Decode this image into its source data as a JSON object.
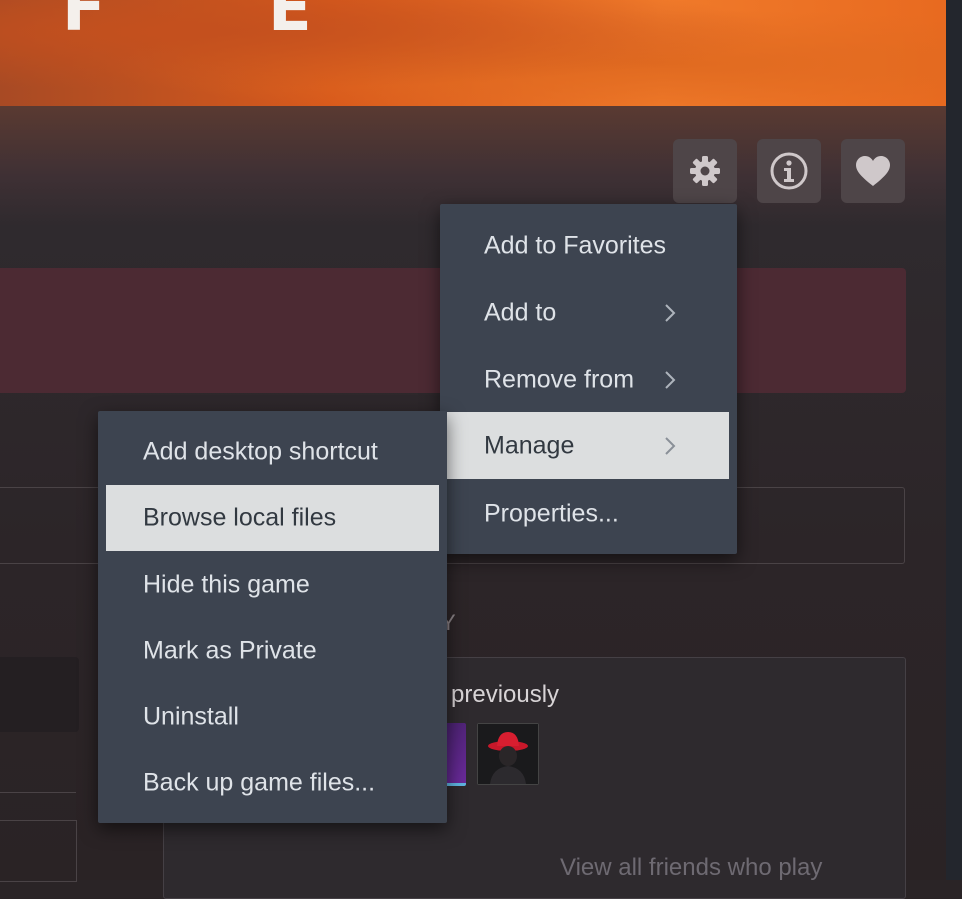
{
  "hero": {
    "title_fragment": "F E"
  },
  "toolbar": {
    "settings_icon": "gear-icon",
    "info_icon": "info-icon",
    "favorite_icon": "heart-icon"
  },
  "context_menu": {
    "items": [
      {
        "label": "Add to Favorites",
        "has_submenu": false
      },
      {
        "label": "Add to",
        "has_submenu": true
      },
      {
        "label": "Remove from",
        "has_submenu": true
      },
      {
        "label": "Manage",
        "has_submenu": true,
        "highlighted": true
      },
      {
        "label": "Properties...",
        "has_submenu": false
      }
    ]
  },
  "manage_submenu": {
    "items": [
      {
        "label": "Add desktop shortcut"
      },
      {
        "label": "Browse local files",
        "highlighted": true
      },
      {
        "label": "Hide this game"
      },
      {
        "label": "Mark as Private"
      },
      {
        "label": "Uninstall"
      },
      {
        "label": "Back up game files..."
      }
    ]
  },
  "friends": {
    "heading_fragment": "Y",
    "played_text": "previously",
    "view_all": "View all friends who play"
  },
  "colors": {
    "menu_bg": "#3d4450",
    "menu_highlight": "#dcdedf",
    "menu_text": "#dfe3e8",
    "banner": "#4c2a33"
  }
}
